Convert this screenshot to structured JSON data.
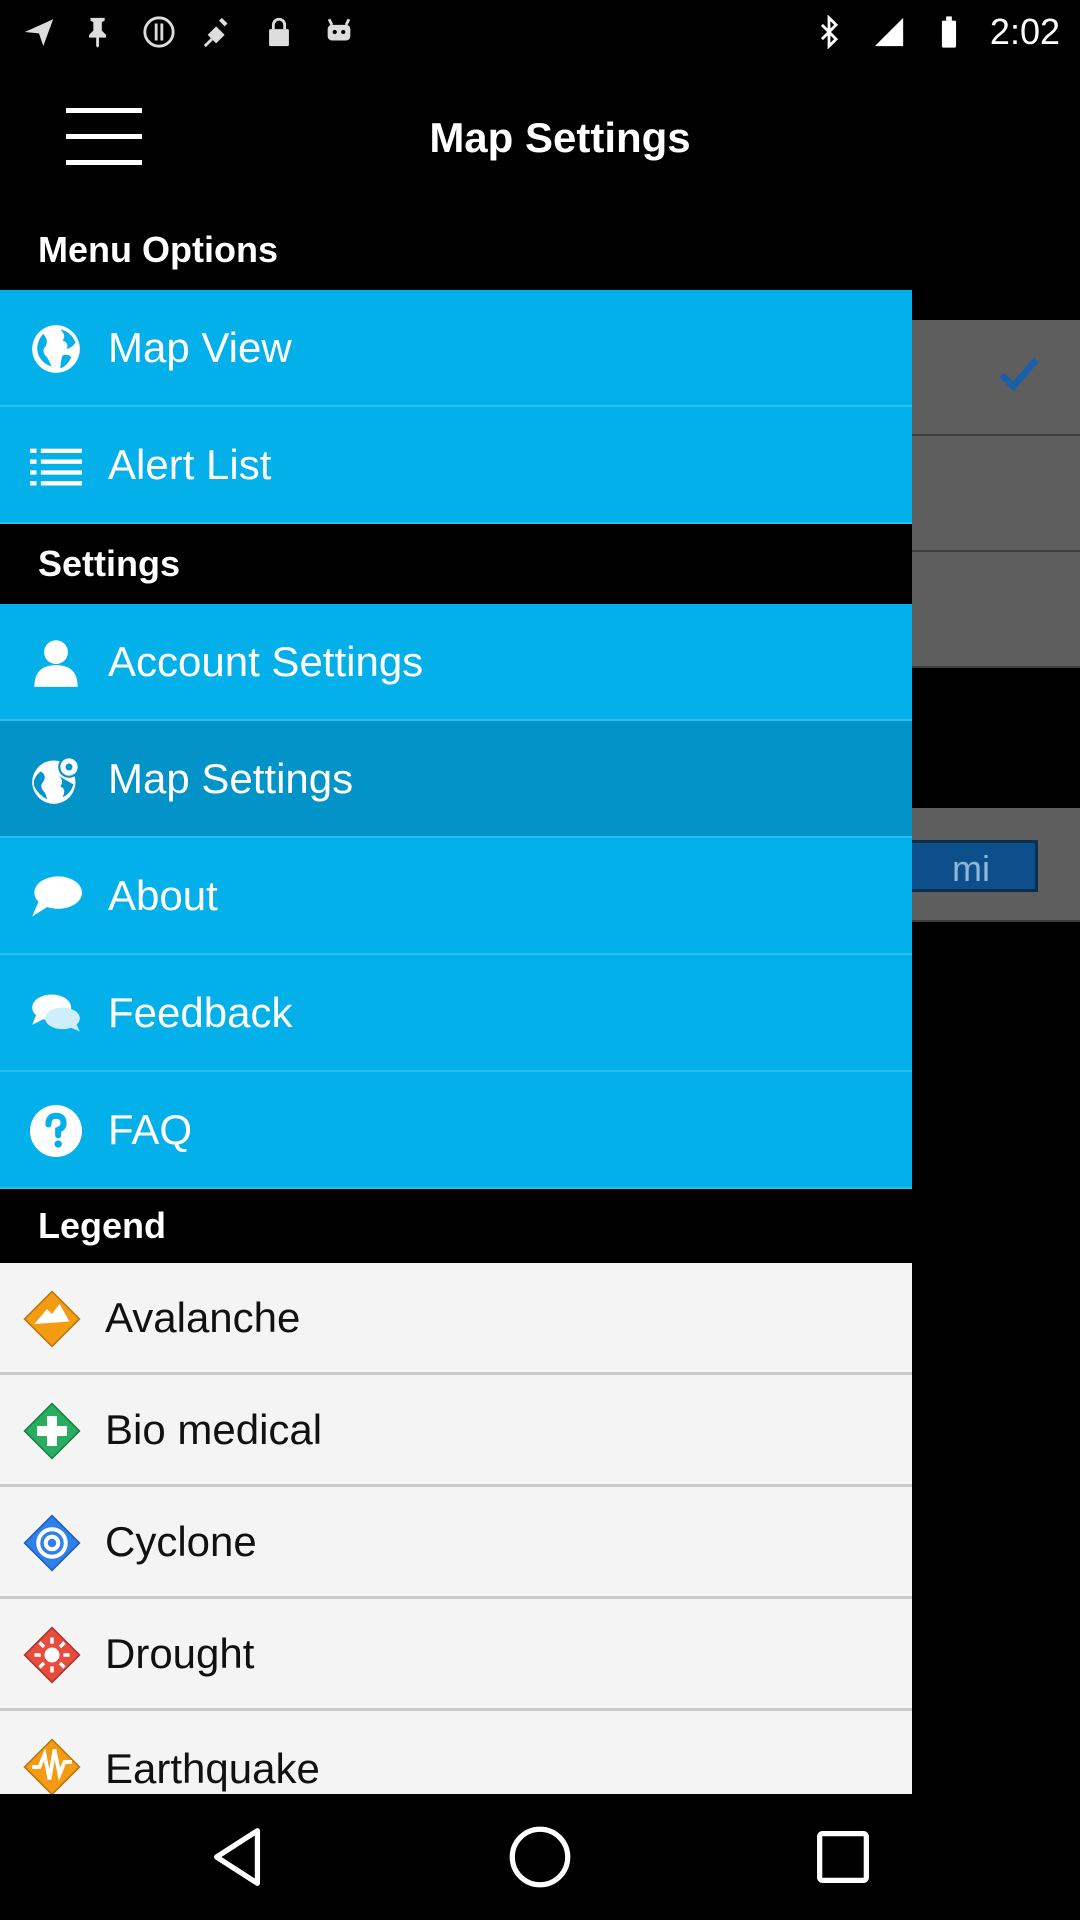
{
  "status_bar": {
    "time": "2:02",
    "left_icons": [
      "navigation-arrow-icon",
      "pin-icon",
      "alert-circle-icon",
      "fake-gps-icon",
      "lock-icon",
      "android-icon"
    ],
    "right_icons": [
      "bluetooth-icon",
      "signal-icon",
      "battery-icon"
    ]
  },
  "header": {
    "title": "Map Settings"
  },
  "background": {
    "unit_label": "mi"
  },
  "drawer": {
    "menu_options_header": "Menu Options",
    "menu_options": [
      {
        "label": "Map View",
        "icon": "globe-icon"
      },
      {
        "label": "Alert List",
        "icon": "list-icon"
      }
    ],
    "settings_header": "Settings",
    "settings": [
      {
        "label": "Account Settings",
        "icon": "person-icon"
      },
      {
        "label": "Map Settings",
        "icon": "globe-gear-icon",
        "selected": true
      },
      {
        "label": "About",
        "icon": "speech-bubble-icon"
      },
      {
        "label": "Feedback",
        "icon": "chat-bubbles-icon"
      },
      {
        "label": "FAQ",
        "icon": "question-icon"
      }
    ],
    "legend_header": "Legend",
    "legend": [
      {
        "label": "Avalanche",
        "icon": "avalanche-icon",
        "color": "#f39c12"
      },
      {
        "label": "Bio medical",
        "icon": "bio-medical-icon",
        "color": "#27ae60"
      },
      {
        "label": "Cyclone",
        "icon": "cyclone-icon",
        "color": "#2f80ed"
      },
      {
        "label": "Drought",
        "icon": "drought-icon",
        "color": "#e74c3c"
      },
      {
        "label": "Earthquake",
        "icon": "earthquake-icon",
        "color": "#f39c12"
      }
    ]
  },
  "colors": {
    "drawer_item": "#03b0ea",
    "drawer_item_selected": "#0294c9",
    "legend_bg": "#f4f4f4"
  }
}
